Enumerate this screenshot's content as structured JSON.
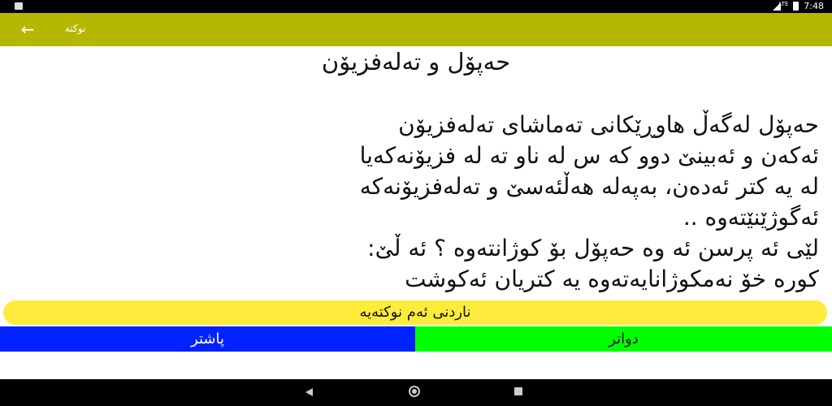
{
  "status_bar": {
    "time": "7:48",
    "network_label": "LTE"
  },
  "app_bar": {
    "title": "نوکتە",
    "back_icon": "arrow-left-icon"
  },
  "joke": {
    "title": "حەپۆل و تەلەفزیۆن",
    "body": "حەپۆل لەگەڵ هاوڕێکانی تەماشای تەلەفزیۆن\nئەکەن و ئەبینێ دوو کە س لە ناو تە لە فزیۆنەکەیا\nلە یە کتر ئەدەن، بەپەلە هەڵئەسێ و تەلەفزیۆنەکە\nئەگوژێنێتەوە ..\nلێی ئە پرسن ئە وە حەپۆل  بۆ کوژانتەوە ؟ ئە ڵێ:\nکورە خۆ نەمکوژانایەتەوە  یە کتریان ئەکوشت"
  },
  "buttons": {
    "send": "ناردنی ئەم نوکتەیە",
    "previous": "پاشتر",
    "next": "دواتر"
  },
  "colors": {
    "app_bar": "#b5b800",
    "send_button": "#ffeb3b",
    "previous_button": "#0022ff",
    "next_button": "#00ff00"
  }
}
